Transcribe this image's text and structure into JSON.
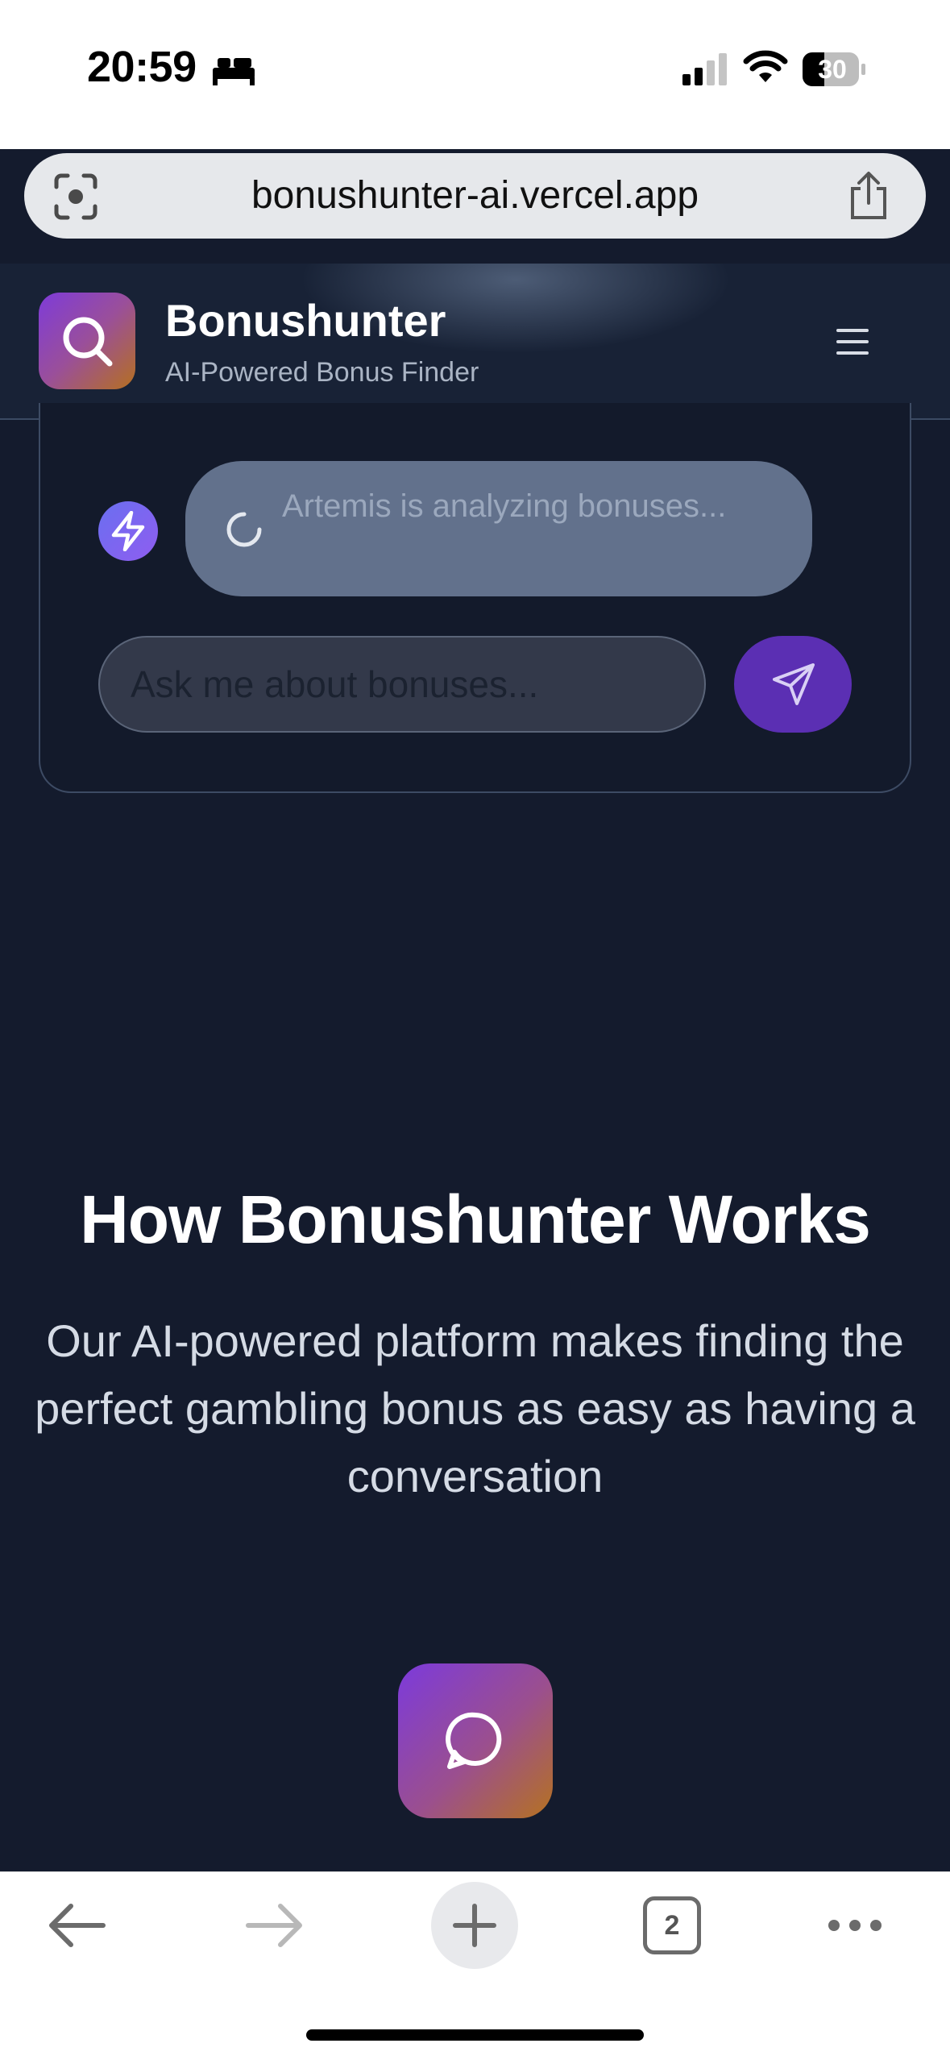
{
  "status_bar": {
    "time": "20:59",
    "battery": "30",
    "icons": [
      "bed-icon",
      "cellular-signal-icon",
      "wifi-icon",
      "battery-icon"
    ]
  },
  "browser": {
    "url": "bonushunter-ai.vercel.app",
    "open_tabs": "2",
    "icons": [
      "scan-icon",
      "share-icon",
      "back-arrow-icon",
      "forward-arrow-icon",
      "plus-icon",
      "more-icon"
    ]
  },
  "header": {
    "brand_name": "Bonushunter",
    "tagline": "AI-Powered Bonus Finder",
    "icons": [
      "search-icon",
      "hamburger-menu-icon"
    ]
  },
  "chat": {
    "loading_text": "Artemis is analyzing bonuses...",
    "input_placeholder": "Ask me about bonuses...",
    "icons": [
      "lightning-icon",
      "spinner-icon",
      "send-icon"
    ]
  },
  "how_it_works": {
    "title": "How Bonushunter Works",
    "description": "Our AI-powered platform makes finding the perfect gambling bonus as easy as having a conversation",
    "feature_icon": "chat-bubble-icon"
  },
  "colors": {
    "background": "#141b2d",
    "accent_purple": "#7e3bd9",
    "accent_orange": "#b5701f",
    "send_button": "#5b2fb3"
  }
}
